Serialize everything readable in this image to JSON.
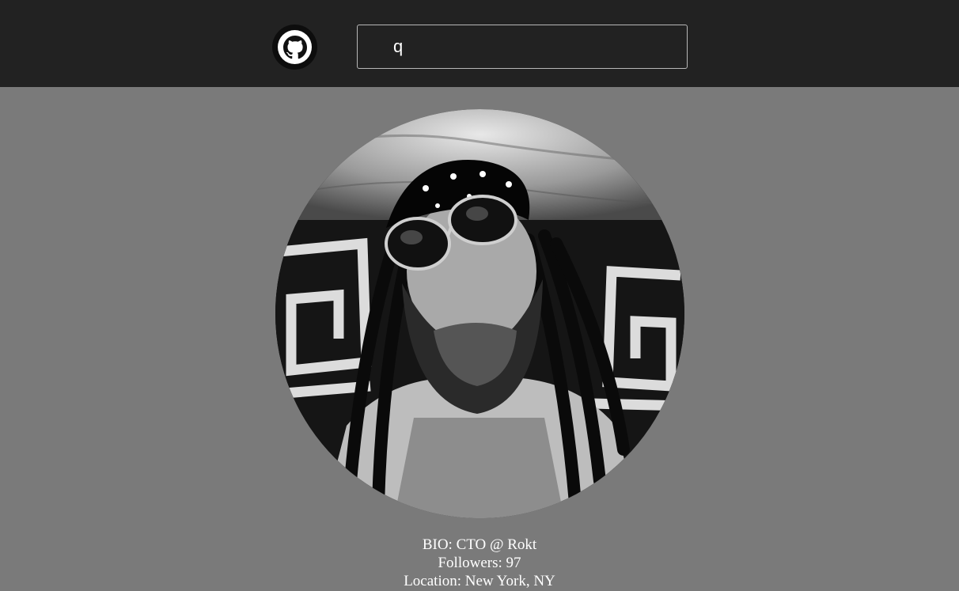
{
  "header": {
    "logo_icon": "github-octocat-icon",
    "search": {
      "value": "q",
      "placeholder": ""
    }
  },
  "profile": {
    "avatar_icon": "user-avatar-photo",
    "bio_prefix": "BIO: ",
    "bio": "CTO @ Rokt",
    "followers_prefix": "Followers: ",
    "followers": "97",
    "location_prefix": "Location: ",
    "location": "New York, NY"
  },
  "colors": {
    "header_bg": "#222222",
    "page_bg": "#7a7a7a",
    "text": "#ffffff"
  }
}
